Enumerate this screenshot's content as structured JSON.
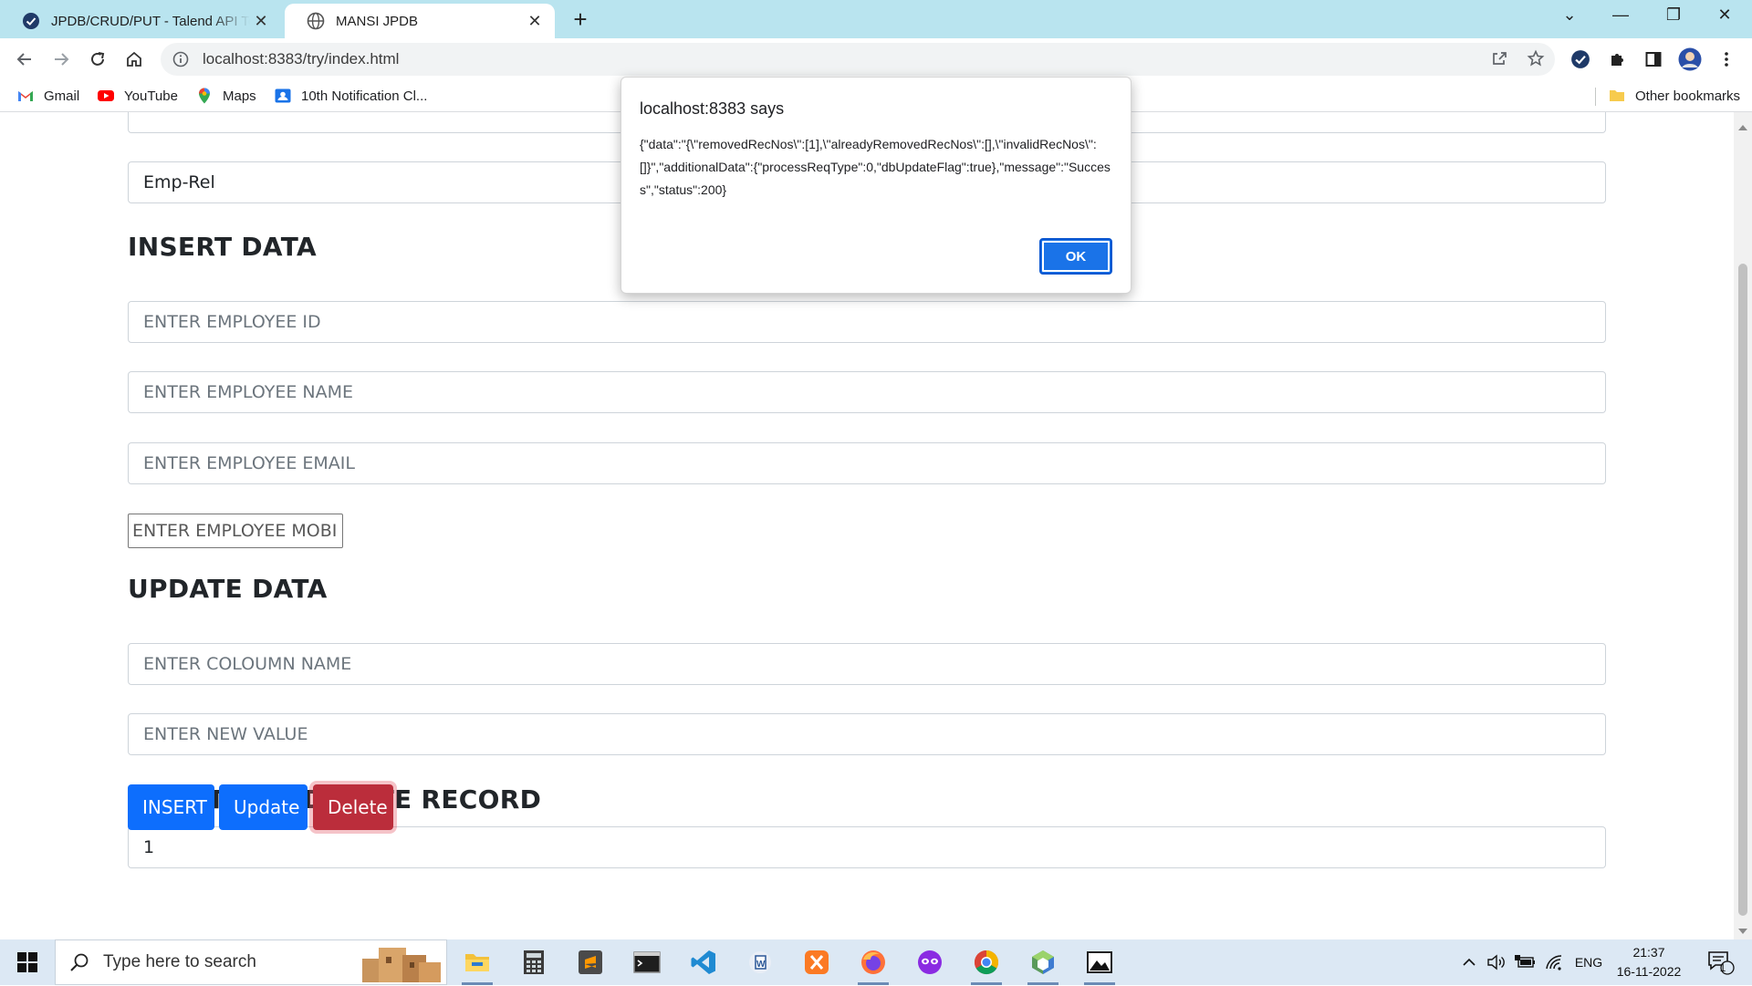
{
  "browser": {
    "tabs": [
      {
        "title": "JPDB/CRUD/PUT - Talend API Tester",
        "close": "✕"
      },
      {
        "title": "MANSI JPDB",
        "close": "✕"
      }
    ],
    "new_tab": "+",
    "window_controls": {
      "dropdown": "⌄",
      "minimize": "—",
      "restore": "❐",
      "close": "✕"
    },
    "url": "localhost:8383/try/index.html"
  },
  "bookmarks": {
    "items": [
      {
        "label": "Gmail"
      },
      {
        "label": "YouTube"
      },
      {
        "label": "Maps"
      },
      {
        "label": "10th Notification Cl..."
      }
    ],
    "other": "Other bookmarks"
  },
  "form": {
    "relation_value": "Emp-Rel",
    "insert_heading": "INSERT DATA",
    "employee_id_placeholder": "ENTER EMPLOYEE ID",
    "employee_name_placeholder": "ENTER EMPLOYEE NAME",
    "employee_email_placeholder": "ENTER EMPLOYEE EMAIL",
    "employee_mobile_placeholder": "ENTER EMPLOYEE MOBILE",
    "update_heading": "UPDATE DATA",
    "column_name_placeholder": "ENTER COLOUMN NAME",
    "new_value_placeholder": "ENTER NEW VALUE",
    "record_heading": "UPDATE OR DELETE RECORD",
    "record_value": "1",
    "buttons": {
      "insert": "INSERT",
      "update": "Update",
      "delete": "Delete"
    }
  },
  "dialog": {
    "title": "localhost:8383 says",
    "message": "{\"data\":\"{\\\"removedRecNos\\\":[1],\\\"alreadyRemovedRecNos\\\":[],\\\"invalidRecNos\\\":[]}\",\"additionalData\":{\"processReqType\":0,\"dbUpdateFlag\":true},\"message\":\"Success\",\"status\":200}",
    "ok": "OK"
  },
  "taskbar": {
    "search_placeholder": "Type here to search",
    "language": "ENG",
    "time": "21:37",
    "date": "16-11-2022",
    "notification_count": "1",
    "apps": [
      "file-explorer",
      "calculator",
      "sublime-text",
      "terminal",
      "vscode",
      "word",
      "xampp",
      "firefox",
      "persona",
      "chrome",
      "app-cube",
      "photos"
    ]
  },
  "colors": {
    "tabstrip": "#b9e4ef",
    "primary": "#0d6efd",
    "danger": "#bb2d3b",
    "dialog_ok": "#1a73e8",
    "taskbar": "#dce8f4"
  }
}
